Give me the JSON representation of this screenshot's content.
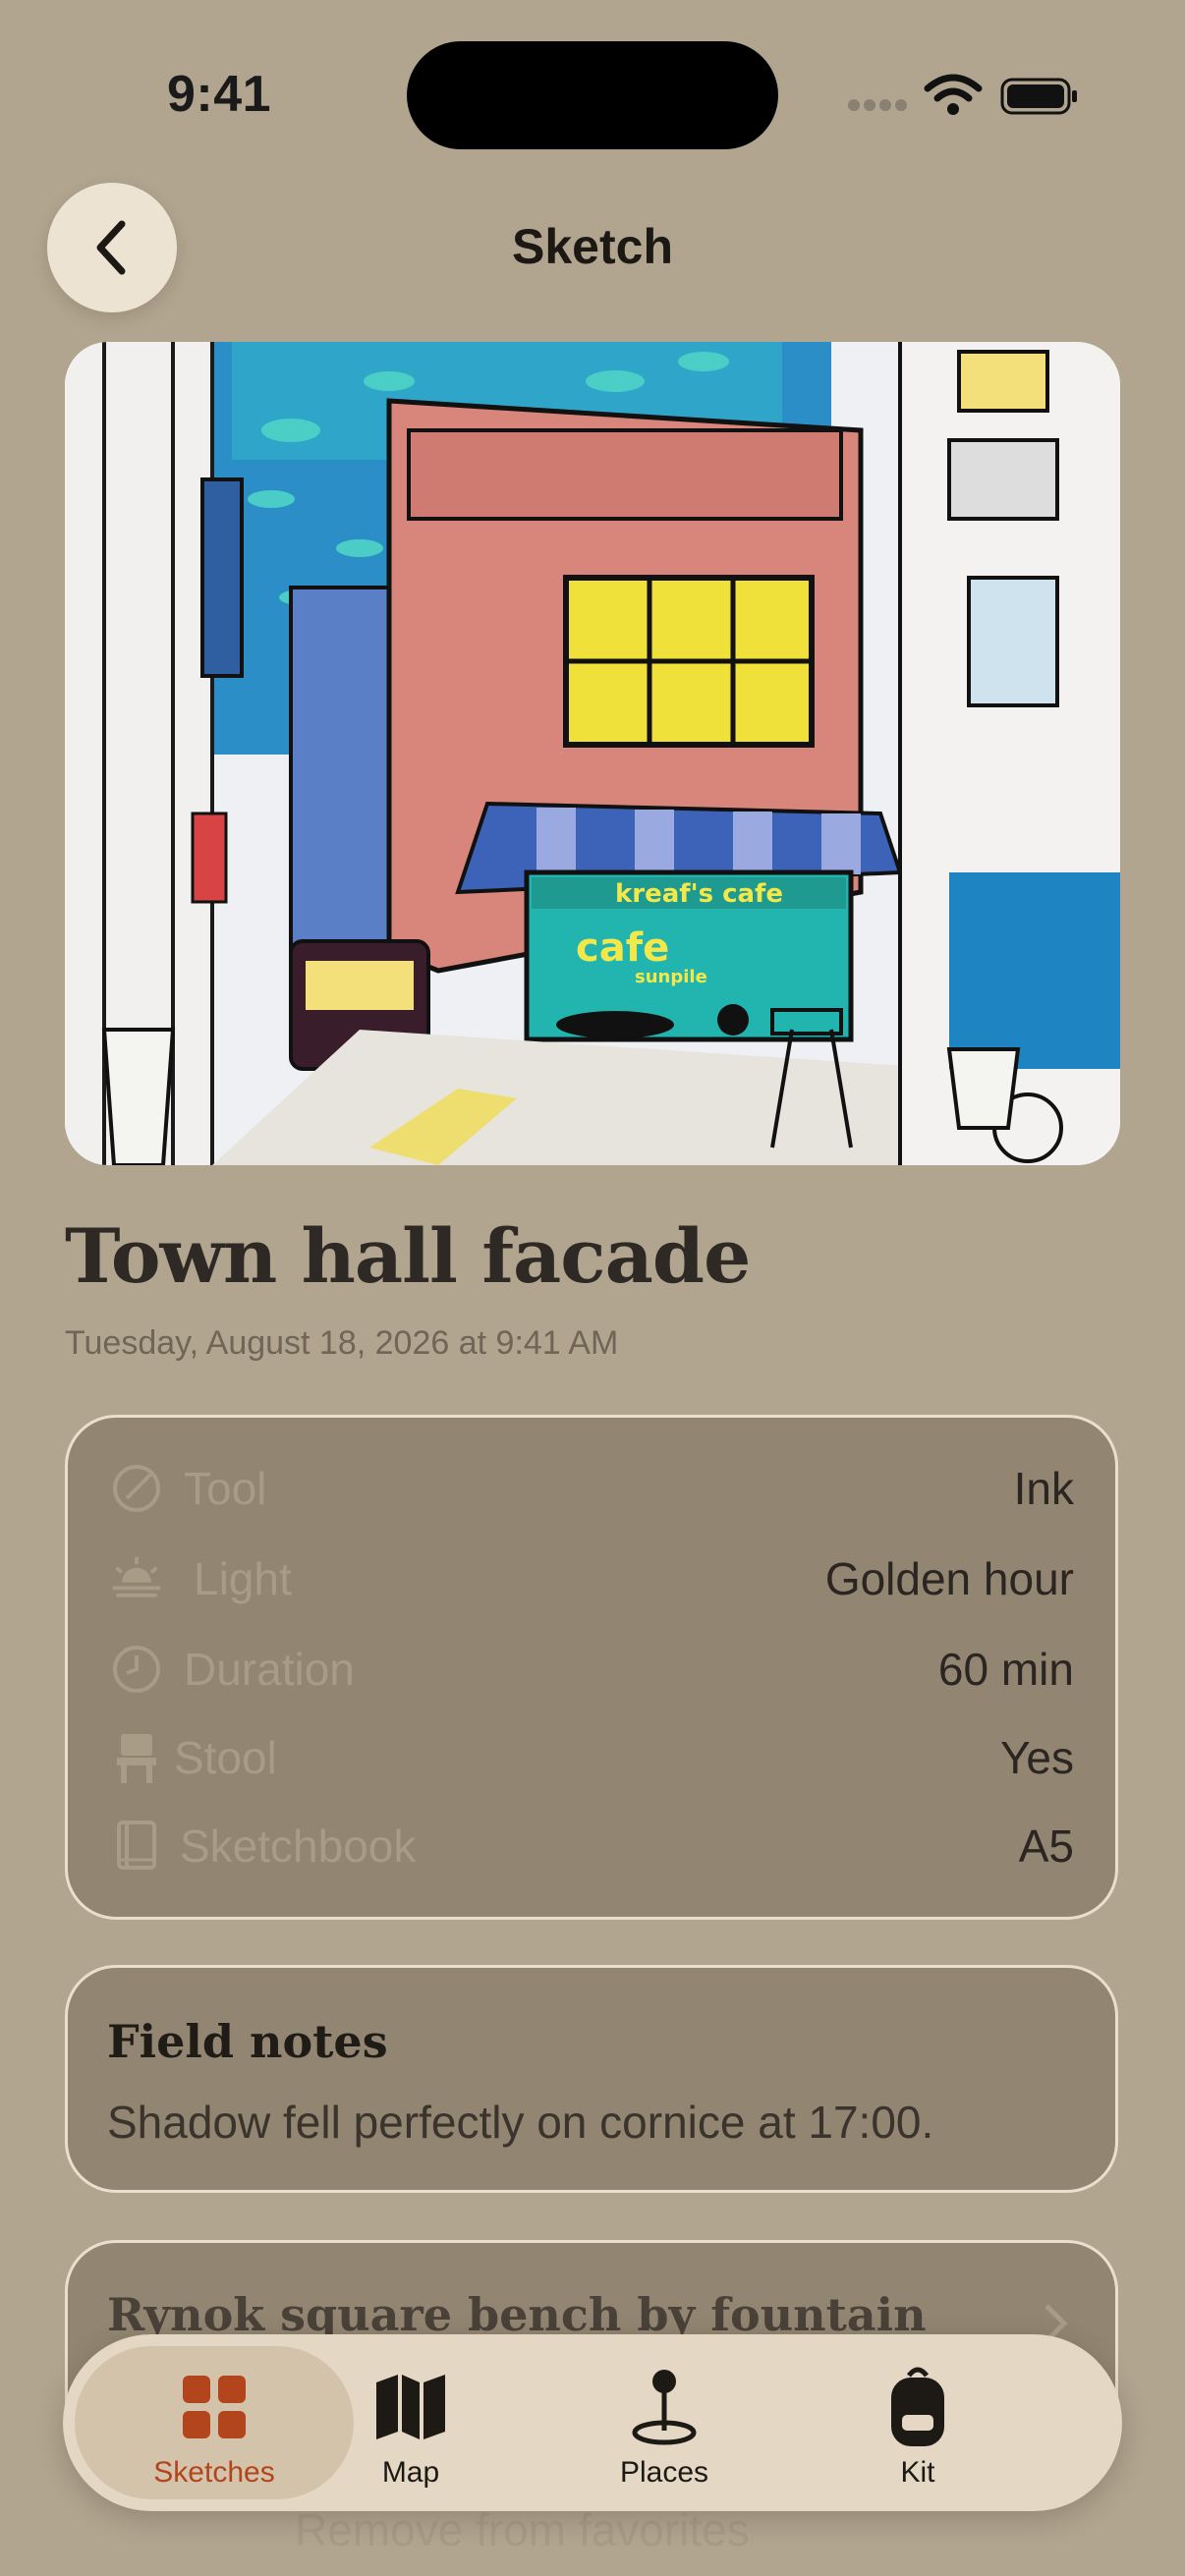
{
  "status_bar": {
    "time": "9:41"
  },
  "nav": {
    "title": "Sketch",
    "back_icon": "chevron-left-icon"
  },
  "sketch": {
    "title": "Town hall facade",
    "date": "Tuesday, August 18, 2026 at 9:41 AM",
    "image_texts": {
      "sign": "kreaf's cafe",
      "window": "cafe",
      "window_sub": "sunpile"
    }
  },
  "details": [
    {
      "icon": "pencil-circle-icon",
      "label": "Tool",
      "value": "Ink"
    },
    {
      "icon": "sunset-icon",
      "label": "Light",
      "value": "Golden hour"
    },
    {
      "icon": "clock-icon",
      "label": "Duration",
      "value": "60 min"
    },
    {
      "icon": "stool-icon",
      "label": "Stool",
      "value": "Yes"
    },
    {
      "icon": "sketchbook-icon",
      "label": "Sketchbook",
      "value": "A5"
    }
  ],
  "field_notes": {
    "title": "Field notes",
    "text": "Shadow fell perfectly on cornice at 17:00."
  },
  "place_card": {
    "title": "Rynok square bench by fountain"
  },
  "ghost_action": {
    "text": "Remove from favorites"
  },
  "tabs": [
    {
      "label": "Sketches",
      "icon": "grid-icon",
      "active": true
    },
    {
      "label": "Map",
      "icon": "map-icon",
      "active": false
    },
    {
      "label": "Places",
      "icon": "pin-icon",
      "active": false
    },
    {
      "label": "Kit",
      "icon": "backpack-icon",
      "active": false
    }
  ],
  "colors": {
    "accent": "#b3451d",
    "background": "#b2a58f",
    "card": "#928571"
  }
}
